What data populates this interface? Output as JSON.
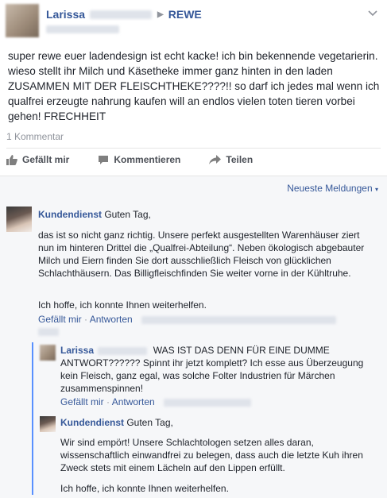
{
  "post": {
    "author": "Larissa",
    "page": "REWE",
    "text": "super rewe euer ladendesign ist echt kacke! ich bin bekennende vegetarierin. wieso stellt ihr Milch und Käsetheke immer ganz hinten in den laden ZUSAMMEN MIT DER FLEISCHTHEKE????!! so darf ich jedes mal wenn ich qualfrei erzeugte nahrung kaufen will an endlos vielen toten tieren vorbei gehen! FRECHHEIT",
    "comment_count": "1 Kommentar"
  },
  "actions": {
    "like": "Gefällt mir",
    "comment": "Kommentieren",
    "share": "Teilen"
  },
  "comments": {
    "sort_label": "Neueste Meldungen",
    "c1": {
      "author": "Kundendienst",
      "greeting": "Guten Tag,",
      "body": "das ist so nicht ganz richtig. Unsere perfekt ausgestellten Warenhäuser ziert nun im hinteren Drittel die „Qualfrei-Abteilung“. Neben ökologisch abgebauter Milch und Eiern finden Sie dort ausschließlich Fleisch von glücklichen Schlachthäusern. Das Billigfleischfinden Sie weiter vorne in der Kühltruhe.",
      "closing": "Ich hoffe, ich konnte Ihnen weiterhelfen.",
      "like": "Gefällt mir",
      "reply": "Antworten"
    },
    "r1": {
      "author": "Larissa",
      "text": "WAS IST DAS DENN FÜR EINE DUMME ANTWORT?????? Spinnt ihr jetzt komplett? Ich esse aus Überzeugung kein Fleisch, ganz egal, was solche Folter Industrien für Märchen zusammenspinnen!",
      "like": "Gefällt mir",
      "reply": "Antworten"
    },
    "r2": {
      "author": "Kundendienst",
      "greeting": "Guten Tag,",
      "body": "Wir sind empört! Unsere Schlachtologen setzen alles daran, wissenschaftlich einwandfrei zu belegen, dass auch die letzte Kuh ihren Zweck stets mit einem Lächeln auf den Lippen erfüllt.",
      "closing": "Ich hoffe, ich konnte Ihnen weiterhelfen."
    }
  },
  "colors": {
    "link": "#365899",
    "reply_bar": "#5890ff",
    "panel_bg": "#f6f7f9"
  },
  "icons": [
    "chevron-down-icon",
    "thumbs-up-icon",
    "comment-icon",
    "share-icon"
  ]
}
